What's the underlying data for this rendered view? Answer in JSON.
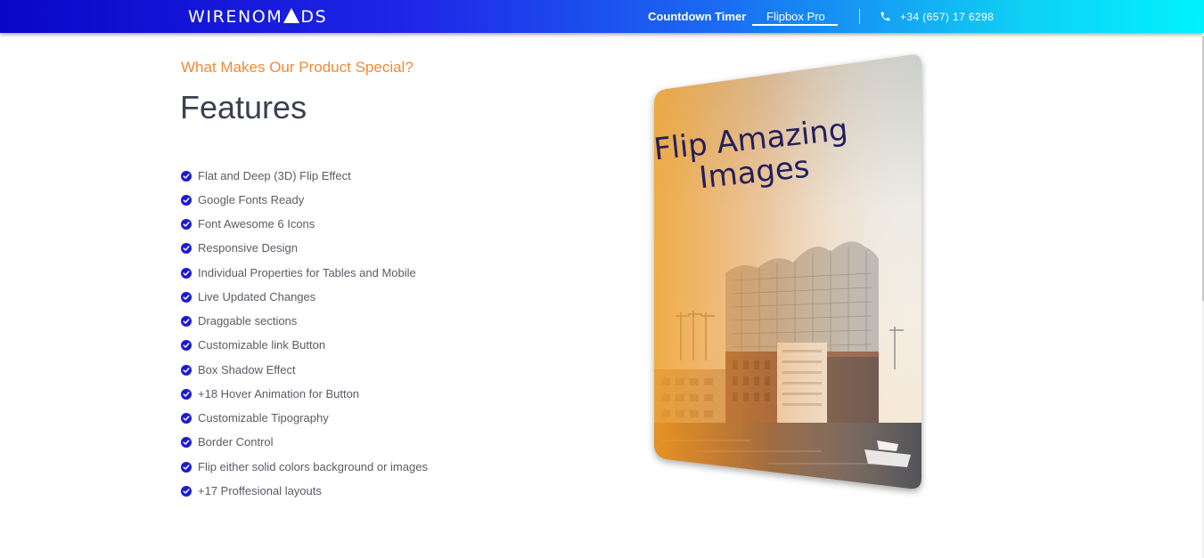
{
  "header": {
    "logo_left": "WIRENOM",
    "logo_right": "DS",
    "nav": [
      {
        "label": "Countdown Timer",
        "active": false
      },
      {
        "label": "Flipbox Pro",
        "active": true
      }
    ],
    "phone": "+34 (657) 17 6298",
    "gradient_colors": [
      "#0a06c8",
      "#1a6cf2",
      "#00f2ff"
    ]
  },
  "main": {
    "subtitle": "What Makes Our Product Special?",
    "title": "Features",
    "features": [
      "Flat and Deep (3D) Flip Effect",
      "Google Fonts Ready",
      "Font Awesome 6 Icons",
      "Responsive Design",
      "Individual Properties for Tables and Mobile",
      "Live Updated Changes",
      "Draggable sections",
      "Customizable link Button",
      "Box Shadow Effect",
      "+18 Hover Animation for Button",
      "Customizable Tipography",
      "Border Control",
      "Flip either solid colors background or images",
      "+17 Proffesional layouts"
    ],
    "accent_color": "#ef8a36",
    "check_color": "#1b1ad0"
  },
  "flipbox": {
    "line1": "Flip Amazing",
    "line2": "Images",
    "icon": "building-photo"
  }
}
